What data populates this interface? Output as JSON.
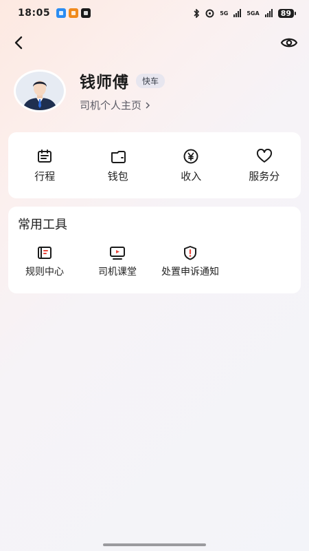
{
  "status_bar": {
    "time": "18:05",
    "network_1": "5G",
    "network_2": "5GA",
    "battery": "89",
    "icons": [
      "bluetooth-icon",
      "location-icon",
      "signal-icon",
      "signal-icon"
    ]
  },
  "nav": {
    "back_icon": "chevron-left-icon",
    "privacy_icon": "eye-icon"
  },
  "profile": {
    "name": "钱师傅",
    "service_tag": "快车",
    "homepage_link": "司机个人主页"
  },
  "main_menu": [
    {
      "label": "行程",
      "icon": "calendar-icon"
    },
    {
      "label": "钱包",
      "icon": "wallet-icon"
    },
    {
      "label": "收入",
      "icon": "yen-icon"
    },
    {
      "label": "服务分",
      "icon": "heart-icon"
    }
  ],
  "tools": {
    "title": "常用工具",
    "items": [
      {
        "label": "规则中心",
        "icon": "rulebook-icon"
      },
      {
        "label": "司机课堂",
        "icon": "video-class-icon"
      },
      {
        "label": "处置申诉通知",
        "icon": "alert-shield-icon"
      }
    ]
  },
  "colors": {
    "accent_red": "#e8473c",
    "text": "#1f1f1f",
    "tag_bg": "#e7e6ef"
  }
}
